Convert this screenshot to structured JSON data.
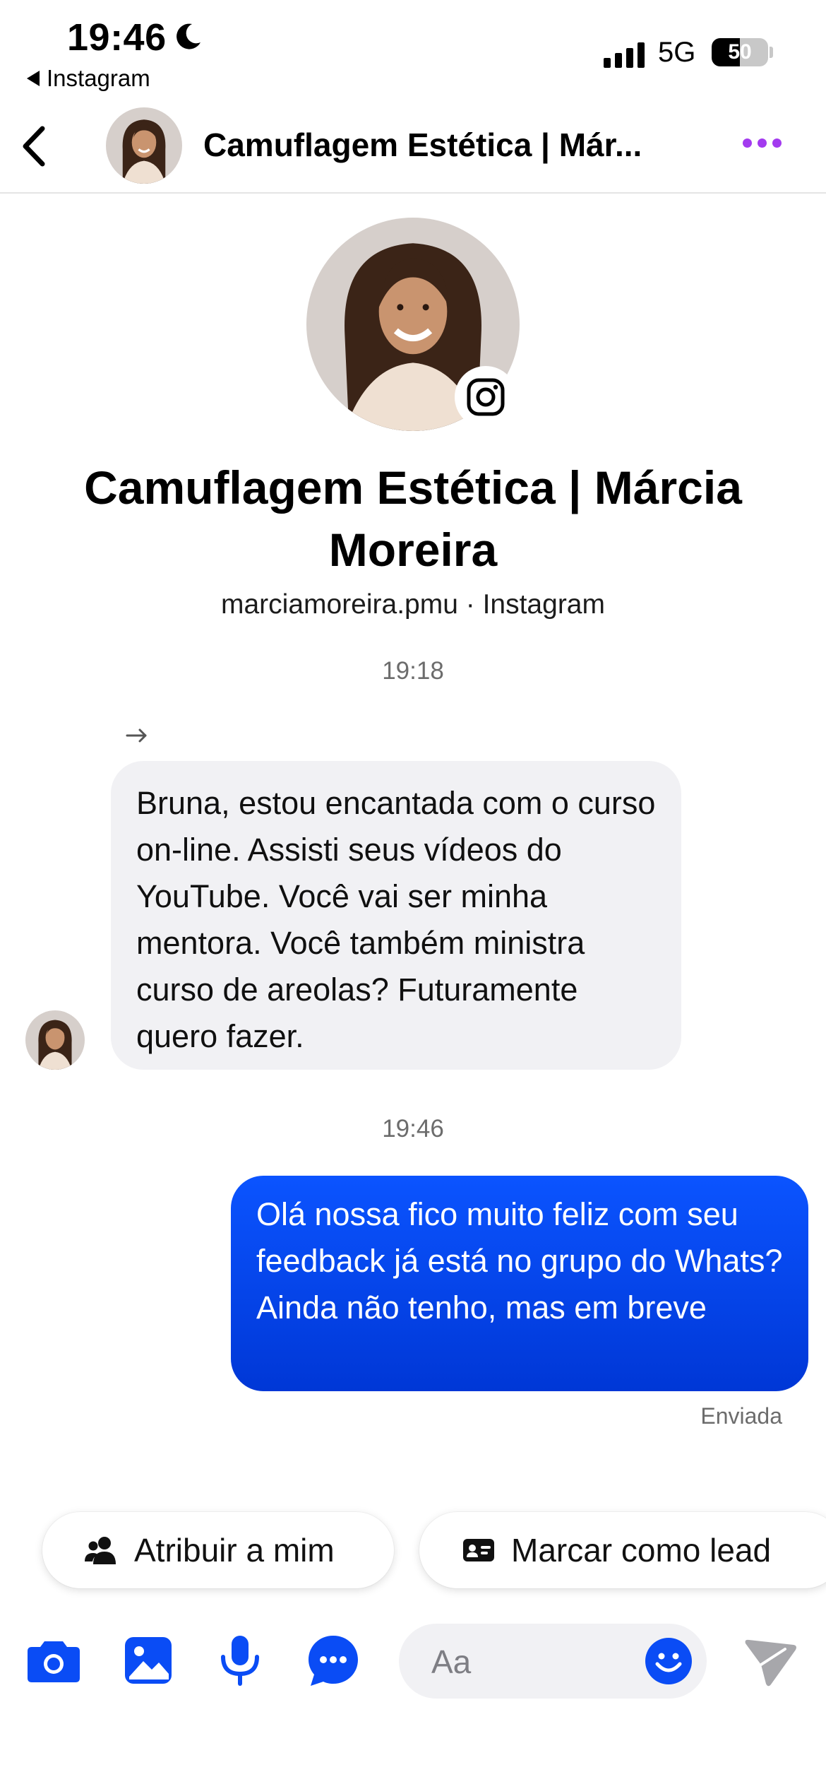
{
  "status_bar": {
    "time": "19:46",
    "back_app": "Instagram",
    "network": "5G",
    "battery": "50",
    "battery_level": 0.5
  },
  "header": {
    "title": "Camuflagem Estética | Már..."
  },
  "profile": {
    "name": "Camuflagem Estética | Márcia Moreira",
    "subtitle": "marciamoreira.pmu · Instagram"
  },
  "messages": [
    {
      "time": "19:18",
      "direction": "incoming",
      "text": "Bruna, estou encantada com o curso on-line. Assisti seus vídeos do YouTube. Você vai ser minha mentora. Você também ministra curso de areolas? Futuramente quero fazer."
    },
    {
      "time": "19:46",
      "direction": "outgoing",
      "text": "Olá nossa fico muito feliz com seu feedback já está no grupo do Whats? Ainda não tenho, mas em breve",
      "status": "Enviada"
    }
  ],
  "actions": {
    "assign_label": "Atribuir a mim",
    "lead_label": "Marcar como lead"
  },
  "composer": {
    "placeholder": "Aa"
  },
  "colors": {
    "accent_blue": "#0a4cf5",
    "more_purple": "#a33bef",
    "incoming_bubble": "#f1f1f4",
    "outgoing_bubble": "#0b54ff"
  },
  "icons": [
    "moon-icon",
    "back-chevron-icon",
    "more-icon",
    "instagram-icon",
    "forward-arrow-icon",
    "person-group-icon",
    "lead-card-icon",
    "camera-icon",
    "gallery-icon",
    "microphone-icon",
    "chat-bubble-icon",
    "emoji-icon",
    "send-icon"
  ]
}
